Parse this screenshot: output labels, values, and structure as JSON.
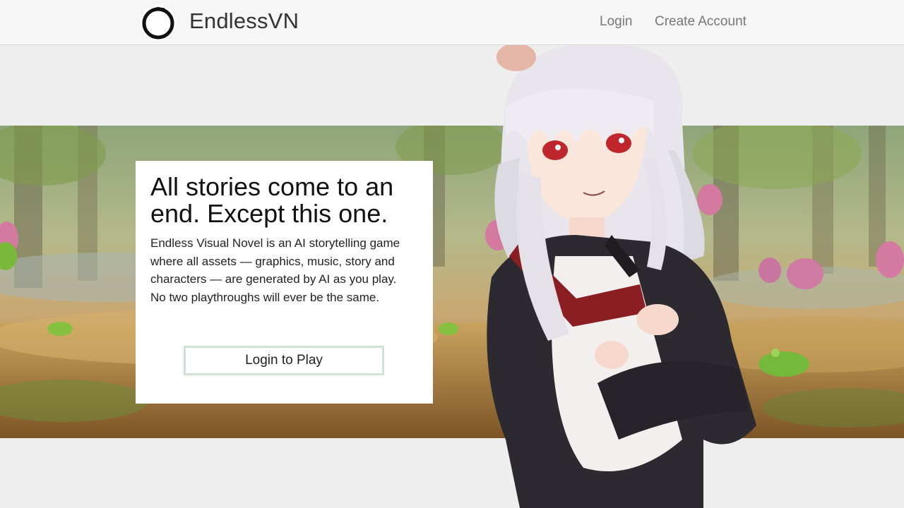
{
  "header": {
    "brand": "EndlessVN",
    "nav": {
      "login": "Login",
      "create_account": "Create Account"
    }
  },
  "hero": {
    "headline": "All stories come to an end. Except this one.",
    "description": "Endless Visual Novel is an AI storytelling game where all assets — graphics, music, story and characters — are generated by AI as you play.",
    "tagline": "No two playthroughs will ever be the same.",
    "cta_label": "Login to Play"
  },
  "colors": {
    "header_bg": "#f6f6f6",
    "page_bg": "#eeeeee",
    "button_border": "#cfe3d5"
  }
}
